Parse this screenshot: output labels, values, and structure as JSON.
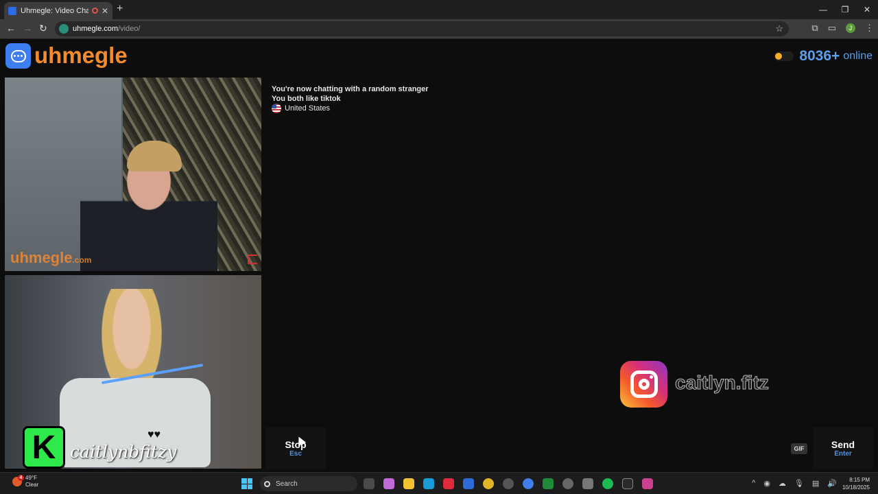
{
  "browser": {
    "tab_title": "Uhmegle: Video Chat | Random",
    "url_host": "uhmegle.com",
    "url_path": "/video/",
    "profile_initial": "J"
  },
  "site": {
    "logo_text": "uhmegle",
    "online_count": "8036+",
    "online_label": "online"
  },
  "video": {
    "watermark": "uhmegle",
    "watermark_suffix": ".com",
    "self_badge_letter": "K",
    "self_handle": "caitlynbfitzy"
  },
  "chat": {
    "messages": [
      "You're now chatting with a random stranger",
      "You both like tiktok"
    ],
    "country": "United States"
  },
  "overlays": {
    "instagram_handle": "caitlyn.fitz",
    "tiktok_handle": "caitlynbfitzy"
  },
  "controls": {
    "stop_label": "Stop",
    "stop_hint": "Esc",
    "message_placeholder": "",
    "gif_label": "GIF",
    "send_label": "Send",
    "send_hint": "Enter"
  },
  "taskbar": {
    "weather_temp": "49°F",
    "weather_desc": "Clear",
    "weather_badge": "4",
    "search_placeholder": "Search",
    "time": "8:15 PM",
    "date": "10/18/2025"
  },
  "colors": {
    "brand_orange": "#f28a2e",
    "brand_blue": "#3d7ff0",
    "online_blue": "#5b9fe8",
    "hint_blue": "#4f93e0"
  }
}
